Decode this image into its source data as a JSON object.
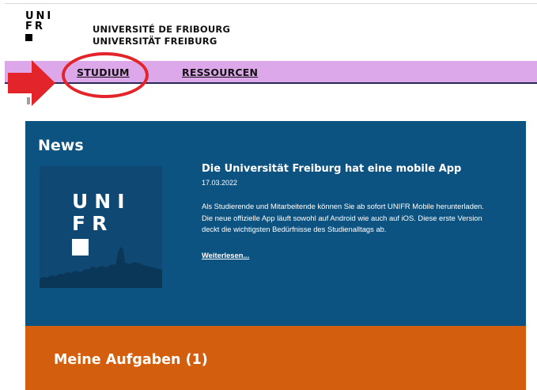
{
  "header": {
    "logo_rows": [
      "UNI",
      "FR"
    ],
    "university_name_fr": "UNIVERSITÉ DE FRIBOURG",
    "university_name_de": "UNIVERSITÄT FREIBURG"
  },
  "nav": {
    "items": [
      {
        "label": "STUDIUM"
      },
      {
        "label": "RESSOURCEN"
      }
    ],
    "background_color": "#dda8ea",
    "highlight_color": "#e3242b"
  },
  "news": {
    "title": "News",
    "background_color": "#0d5382",
    "thumbnail": {
      "logo_rows": [
        "UNI",
        "FR"
      ],
      "icon": "unifr-logo-skyline-icon"
    },
    "article": {
      "title": "Die Universität Freiburg hat eine mobile App",
      "date": "17.03.2022",
      "body": "Als Studierende und Mitarbeitende können Sie ab sofort UNIFR Mobile herunterladen. Die neue offizielle App läuft sowohl auf Android wie auch auf iOS. Diese erste Version deckt die wichtigsten Bedürfnisse des Studienalltags ab.",
      "read_more": "Weiterlesen..."
    }
  },
  "tasks": {
    "title": "Meine Aufgaben (1)",
    "background_color": "#d35f0e"
  }
}
